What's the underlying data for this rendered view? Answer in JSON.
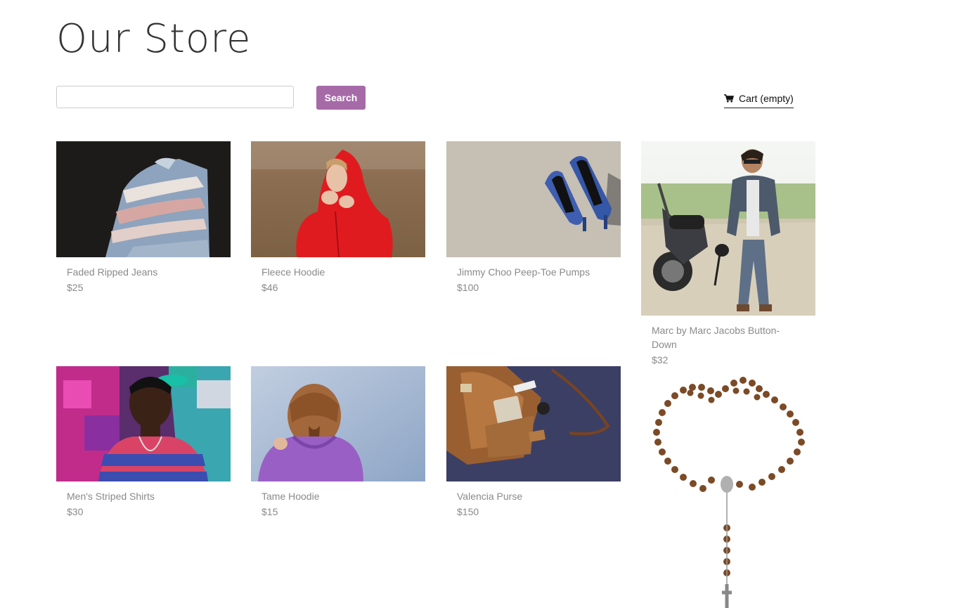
{
  "page": {
    "title": "Our Store"
  },
  "search": {
    "value": "",
    "placeholder": "",
    "button_label": "Search"
  },
  "cart": {
    "label": "Cart (empty)",
    "icon": "cart-icon"
  },
  "colors": {
    "accent": "#a66aa7",
    "product_text": "#8a8a8a"
  },
  "products": [
    {
      "name": "Faded Ripped Jeans",
      "price": "$25",
      "image": "ripped-jeans-photo"
    },
    {
      "name": "Fleece Hoodie",
      "price": "$46",
      "image": "red-hoodie-photo"
    },
    {
      "name": "Jimmy Choo Peep-Toe Pumps",
      "price": "$100",
      "image": "blue-pumps-photo"
    },
    {
      "name": "Marc by Marc Jacobs Button-Down",
      "price": "$32",
      "image": "man-motorcycle-photo"
    },
    {
      "name": "Men's Striped Shirts",
      "price": "$30",
      "image": "striped-shirt-man-photo"
    },
    {
      "name": "Tame Hoodie",
      "price": "$15",
      "image": "purple-hoodie-photo"
    },
    {
      "name": "Valencia Purse",
      "price": "$150",
      "image": "leather-purse-photo"
    },
    {
      "name": "",
      "price": "",
      "image": "rosary-photo"
    }
  ]
}
